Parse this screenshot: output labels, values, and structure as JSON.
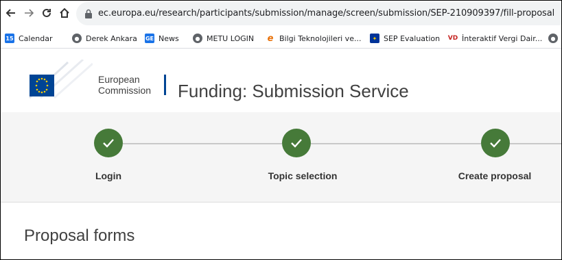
{
  "browser": {
    "back_icon": "arrow-left-icon",
    "forward_icon": "arrow-right-icon",
    "reload_icon": "reload-icon",
    "home_icon": "home-icon",
    "url": "ec.europa.eu/research/participants/submission/manage/screen/submission/SEP-210909397/fill-proposal"
  },
  "bookmarks": [
    {
      "label": "Calendar",
      "icon": "calendar-icon",
      "color": "#1a73e8"
    },
    {
      "label": "Derek Ankara",
      "icon": "globe-icon",
      "color": "#5f6368"
    },
    {
      "label": "News",
      "icon": "news-icon",
      "color": "#1a73e8"
    },
    {
      "label": "METU LOGIN",
      "icon": "globe-icon",
      "color": "#5f6368"
    },
    {
      "label": "Bilgi Teknolojileri ve...",
      "icon": "edge-icon",
      "color": "#e8710a"
    },
    {
      "label": "SEP Evaluation",
      "icon": "eu-flag-icon",
      "color": "#003399"
    },
    {
      "label": "İnteraktif Vergi Dair...",
      "icon": "vd-icon",
      "color": "#c5221f"
    }
  ],
  "header": {
    "org_line1": "European",
    "org_line2": "Commission",
    "service_title": "Funding: Submission Service",
    "accent": "#004494"
  },
  "steps": [
    {
      "label": "Login",
      "status": "completed"
    },
    {
      "label": "Topic selection",
      "status": "completed"
    },
    {
      "label": "Create proposal",
      "status": "completed"
    }
  ],
  "colors": {
    "step_complete": "#467a39"
  },
  "main": {
    "section_title": "Proposal forms"
  }
}
